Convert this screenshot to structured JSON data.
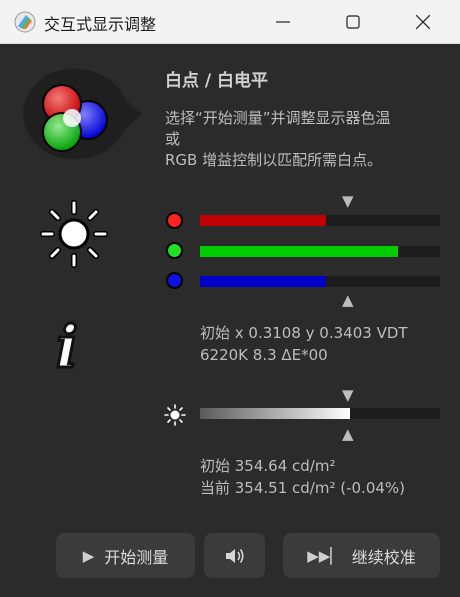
{
  "window": {
    "title": "交互式显示调整"
  },
  "header": {
    "title": "白点 / 白电平",
    "description_lines": [
      "选择“开始测量”并调整显示器色温",
      "或",
      "RGB 增益控制以匹配所需白点。"
    ]
  },
  "rgb_gains": {
    "red": {
      "fraction": 0.525,
      "color": "#c00000"
    },
    "green": {
      "fraction": 0.825,
      "color": "#00cc00"
    },
    "blue": {
      "fraction": 0.525,
      "color": "#0000c8"
    }
  },
  "whitepoint": {
    "line1": "初始 x 0.3108 y 0.3403 VDT",
    "line2": "6220K 8.3 ΔE*00"
  },
  "luminance": {
    "fraction": 0.625,
    "line1": "初始 354.64 cd/m²",
    "line2": "当前 354.51 cd/m² (-0.04%)"
  },
  "buttons": {
    "start_label": "开始测量",
    "continue_label": "继续校准"
  },
  "icons": {
    "start": "play-icon",
    "sound": "speaker-icon",
    "continue": "skip-forward-icon"
  }
}
